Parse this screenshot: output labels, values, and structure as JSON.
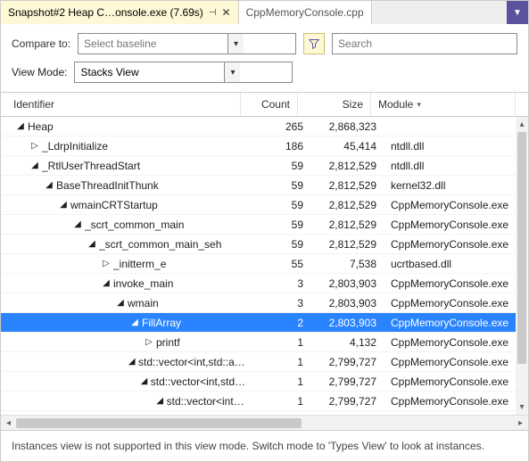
{
  "tabs": {
    "active": {
      "title": "Snapshot#2 Heap C…onsole.exe (7.69s)"
    },
    "inactive": {
      "title": "CppMemoryConsole.cpp"
    }
  },
  "toolbar": {
    "compare_label": "Compare to:",
    "baseline_placeholder": "Select baseline",
    "search_placeholder": "Search",
    "viewmode_label": "View Mode:",
    "viewmode_value": "Stacks View"
  },
  "headers": {
    "identifier": "Identifier",
    "count": "Count",
    "size": "Size",
    "module": "Module"
  },
  "rows": [
    {
      "indent": 0,
      "toggle": "expanded",
      "identifier": "Heap",
      "count": "265",
      "size": "2,868,323",
      "module": "",
      "selected": false
    },
    {
      "indent": 1,
      "toggle": "collapsed",
      "identifier": "_LdrpInitialize",
      "count": "186",
      "size": "45,414",
      "module": "ntdll.dll",
      "selected": false
    },
    {
      "indent": 1,
      "toggle": "expanded",
      "identifier": "_RtlUserThreadStart",
      "count": "59",
      "size": "2,812,529",
      "module": "ntdll.dll",
      "selected": false
    },
    {
      "indent": 2,
      "toggle": "expanded",
      "identifier": "BaseThreadInitThunk",
      "count": "59",
      "size": "2,812,529",
      "module": "kernel32.dll",
      "selected": false
    },
    {
      "indent": 3,
      "toggle": "expanded",
      "identifier": "wmainCRTStartup",
      "count": "59",
      "size": "2,812,529",
      "module": "CppMemoryConsole.exe",
      "selected": false
    },
    {
      "indent": 4,
      "toggle": "expanded",
      "identifier": "_scrt_common_main",
      "count": "59",
      "size": "2,812,529",
      "module": "CppMemoryConsole.exe",
      "selected": false
    },
    {
      "indent": 5,
      "toggle": "expanded",
      "identifier": "_scrt_common_main_seh",
      "count": "59",
      "size": "2,812,529",
      "module": "CppMemoryConsole.exe",
      "selected": false
    },
    {
      "indent": 6,
      "toggle": "collapsed",
      "identifier": "_initterm_e",
      "count": "55",
      "size": "7,538",
      "module": "ucrtbased.dll",
      "selected": false
    },
    {
      "indent": 6,
      "toggle": "expanded",
      "identifier": "invoke_main",
      "count": "3",
      "size": "2,803,903",
      "module": "CppMemoryConsole.exe",
      "selected": false
    },
    {
      "indent": 7,
      "toggle": "expanded",
      "identifier": "wmain",
      "count": "3",
      "size": "2,803,903",
      "module": "CppMemoryConsole.exe",
      "selected": false
    },
    {
      "indent": 8,
      "toggle": "expanded",
      "identifier": "FillArray",
      "count": "2",
      "size": "2,803,903",
      "module": "CppMemoryConsole.exe",
      "selected": true
    },
    {
      "indent": 9,
      "toggle": "collapsed",
      "identifier": "printf",
      "count": "1",
      "size": "4,132",
      "module": "CppMemoryConsole.exe",
      "selected": false
    },
    {
      "indent": 9,
      "toggle": "expanded",
      "identifier": "std::vector<int,std::alloc…",
      "count": "1",
      "size": "2,799,727",
      "module": "CppMemoryConsole.exe",
      "selected": false
    },
    {
      "indent": 10,
      "toggle": "expanded",
      "identifier": "std::vector<int,std::al…",
      "count": "1",
      "size": "2,799,727",
      "module": "CppMemoryConsole.exe",
      "selected": false
    },
    {
      "indent": 11,
      "toggle": "expanded",
      "identifier": "std::vector<int,st…",
      "count": "1",
      "size": "2,799,727",
      "module": "CppMemoryConsole.exe",
      "selected": false
    }
  ],
  "footer": "Instances view is not supported in this view mode. Switch mode to 'Types View' to look at instances."
}
